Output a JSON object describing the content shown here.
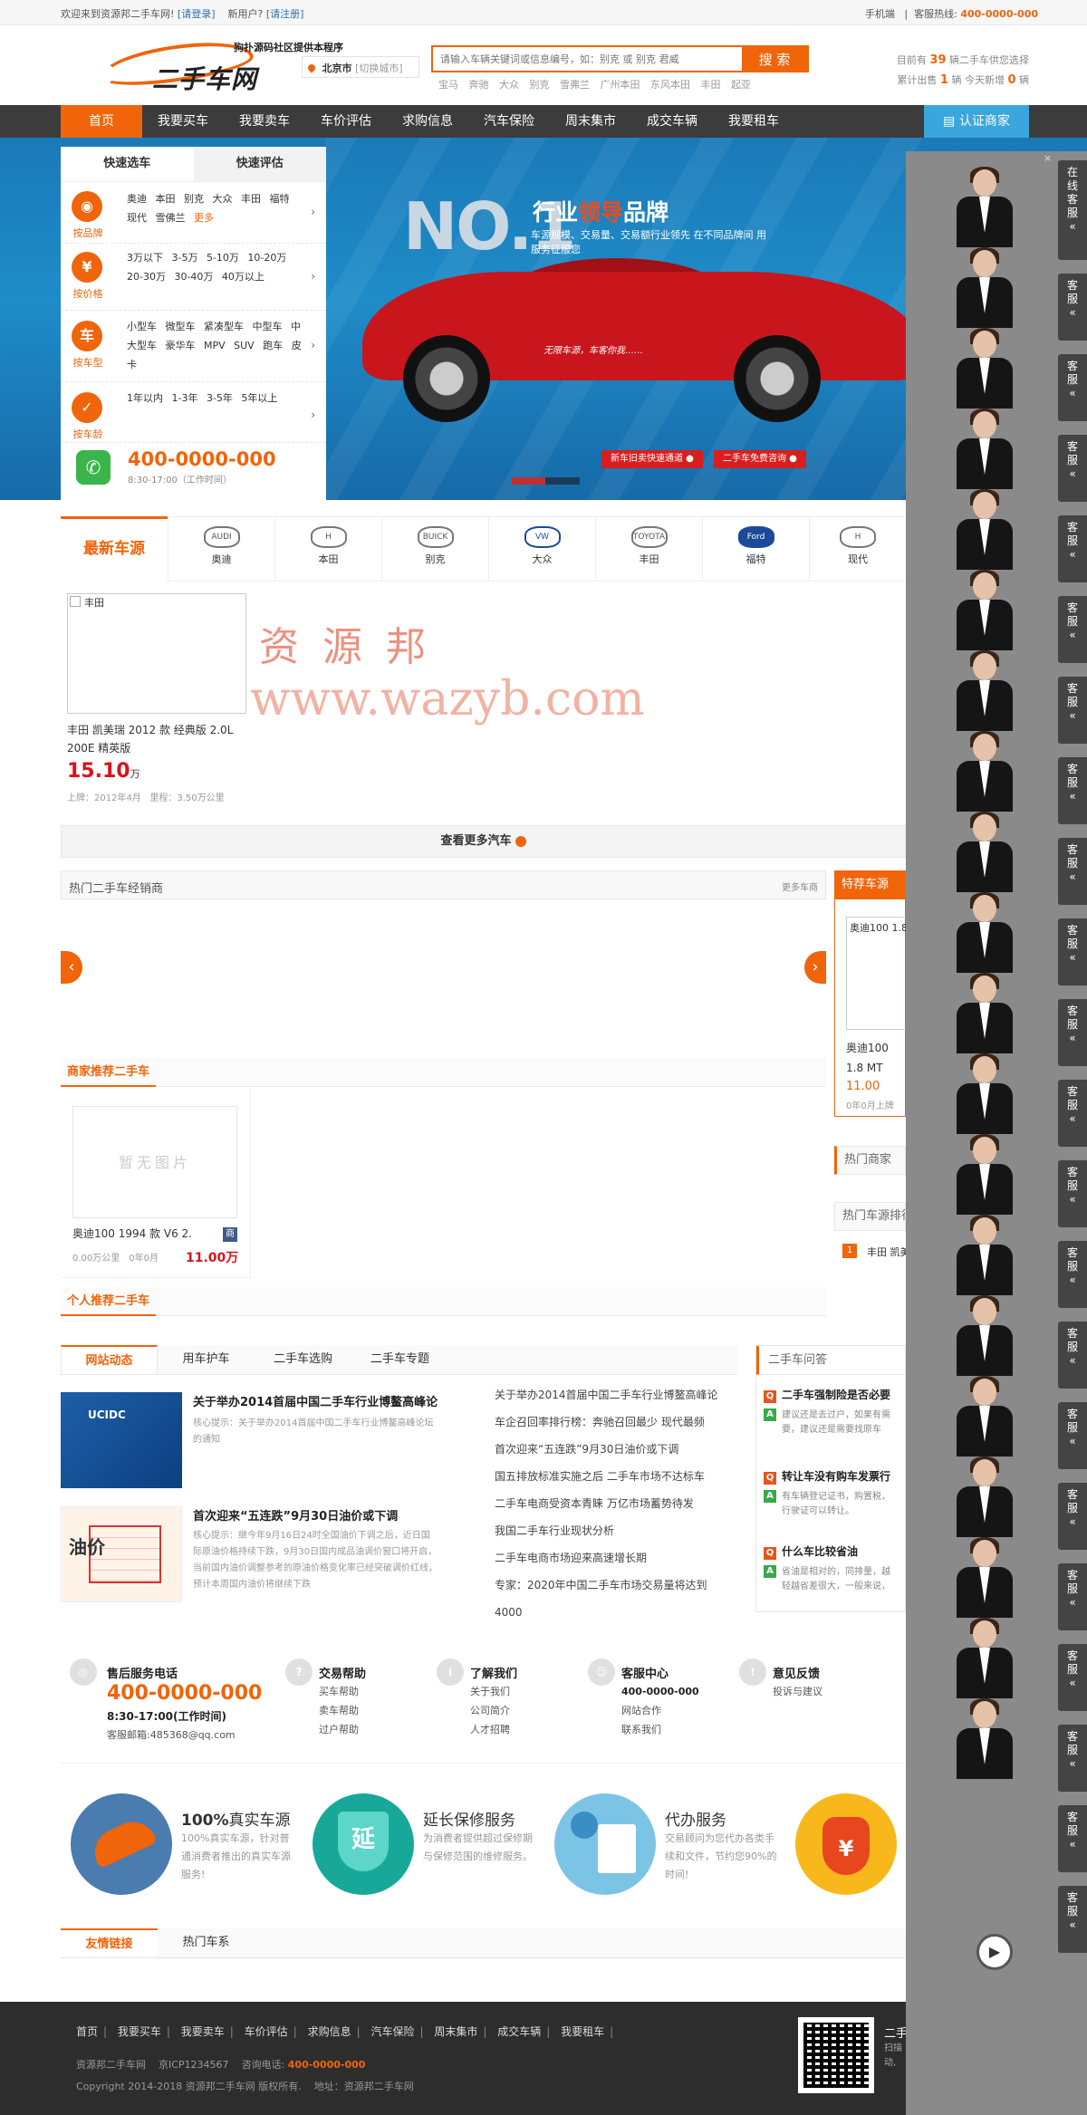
{
  "topbar": {
    "welcome": "欢迎来到资源邦二手车网!",
    "login": "[请登录]",
    "newuser": "新用户?",
    "register": "[请注册]",
    "mobile": "手机端",
    "hotline_label": "客服热线:",
    "hotline": "400-0000-000"
  },
  "header": {
    "logo_text": "二手车网",
    "logo_sub": "狗扑源码社区提供本程序",
    "city": "北京市",
    "city_switch": "[切换城市]",
    "search_placeholder": "请输入车辆关键词或信息编号，如：别克 或 别克 君威",
    "search_btn": "搜 索",
    "hotkeys": "宝马 奔驰 大众 别克 雪弗兰 广州本田 东风本田 丰田 起亚",
    "stat1_pre": "目前有",
    "stat1_num": "39",
    "stat1_post": "辆二手车供您选择",
    "stat2_pre": "累计出售",
    "stat2_num": "1",
    "stat2_mid": "辆 今天新增",
    "stat2_num2": "0",
    "stat2_post": "辆"
  },
  "nav": {
    "items": [
      "首页",
      "我要买车",
      "我要卖车",
      "车价评估",
      "求购信息",
      "汽车保险",
      "周末集市",
      "成交车辆",
      "我要租车"
    ],
    "cert": "认证商家"
  },
  "banner": {
    "no1": "NO.1",
    "slogan_a": "行业",
    "slogan_b": "领导",
    "slogan_c": "品牌",
    "slogan2": "车源规模、交易量、交易额行业领先 在不同品牌间 用服务征服您",
    "btn1": "新车旧卖快速通道",
    "btn2": "二手车免费咨询",
    "car_plate": "无限车源，车客你我……"
  },
  "quick": {
    "tab1": "快速选车",
    "tab2": "快速评估",
    "rows": [
      {
        "icon": "◉",
        "label": "按品牌",
        "text": "奥迪 本田 别克 大众 丰田 福特 现代 雪佛兰",
        "more": "更多"
      },
      {
        "icon": "¥",
        "label": "按价格",
        "text": "3万以下 3-5万 5-10万 10-20万 20-30万 30-40万 40万以上",
        "more": ""
      },
      {
        "icon": "车",
        "label": "按车型",
        "text": "小型车 微型车 紧凑型车 中型车 中大型车 豪华车 MPV SUV 跑车 皮卡",
        "more": ""
      },
      {
        "icon": "✓",
        "label": "按车龄",
        "text": "1年以内 1-3年 3-5年 5年以上",
        "more": ""
      }
    ],
    "phone": "400-0000-000",
    "phone_time": "8:30-17:00（工作时间）"
  },
  "brands": {
    "title": "最新车源",
    "items": [
      {
        "name": "奥迪",
        "logo": "AUDI"
      },
      {
        "name": "本田",
        "logo": "H"
      },
      {
        "name": "别克",
        "logo": "BUICK"
      },
      {
        "name": "大众",
        "logo": "VW"
      },
      {
        "name": "丰田",
        "logo": "TOYOTA"
      },
      {
        "name": "福特",
        "logo": "Ford"
      },
      {
        "name": "现代",
        "logo": "H"
      }
    ]
  },
  "latest": {
    "img_alt": "丰田",
    "name": "丰田 凯美瑞 2012 款 经典版 2.0L 200E 精英版",
    "price": "15.10",
    "unit": "万",
    "reg": "上牌：2012年4月",
    "mileage": "里程：3.50万公里",
    "wm1": "资 源 邦",
    "wm2": "www.wazyb.com",
    "more": "查看更多汽车"
  },
  "dealers": {
    "title": "热门二手车经销商",
    "more": "更多车商",
    "special": "特荐车源",
    "sp_name": "奥迪100 1.8 MT",
    "sp_price": "11.00",
    "sp_meta": "0年0月上牌",
    "side1": "热门商家",
    "side2": "热门车源排行",
    "rank_no": "1",
    "rank_name": "丰田 凯美瑞"
  },
  "merchant": {
    "title": "商家推荐二手车",
    "noimg": "暂无图片",
    "name": "奥迪100 1994 款 V6 2.",
    "tag": "商",
    "meta": "0.00万公里　0年0月",
    "price": "11.00万"
  },
  "personal": {
    "title": "个人推荐二手车"
  },
  "news": {
    "tabs": [
      "网站动态",
      "用车护车",
      "二手车选购",
      "二手车专题"
    ],
    "img1_text": "UCIDC",
    "h1": "关于举办2014首届中国二手车行业博鳌高峰论",
    "d1": "核心提示：关于举办2014首届中国二手车行业博鳌高峰论坛的通知",
    "img2_text": "油价",
    "h2": "首次迎来“五连跌”9月30日油价或下调",
    "d2": "核心提示：继今年9月16日24时全国油价下调之后，近日国际原油价格持续下跌，9月30日国内成品油调价窗口将开启，当前国内油价调整参考的原油价格变化率已经突破调价红线，预计本周国内油价将继续下跌",
    "list": [
      "关于举办2014首届中国二手车行业博鳌高峰论",
      "车企召回率排行榜：奔驰召回最少 现代最频",
      "首次迎来“五连跌”9月30日油价或下调",
      "国五排放标准实施之后 二手车市场不达标车",
      "二手车电商受资本青睐 万亿市场蓄势待发",
      "我国二手车行业现状分析",
      "二手车电商市场迎来高速增长期",
      "专家：2020年中国二手车市场交易量将达到",
      "4000"
    ]
  },
  "qa": {
    "title": "二手车问答",
    "items": [
      {
        "q": "二手车强制险是否必要",
        "a": "建议还是去过户，如果有需要，建议还是需要找原车主，因为"
      },
      {
        "q": "转让车没有购车发票行",
        "a": "有车辆登记证书，购置税，行驶证可以转让。"
      },
      {
        "q": "什么车比较省油",
        "a": "省油是相对的，同排量，越轻越省差很大，一般来说，排量"
      }
    ]
  },
  "service": {
    "c1_h": "售后服务电话",
    "c1_phone": "400-0000-000",
    "c1_time": "8:30-17:00(工作时间)",
    "c1_mail": "客服邮箱:485368@qq.com",
    "c2_h": "交易帮助",
    "c2_l": [
      "买车帮助",
      "卖车帮助",
      "过户帮助"
    ],
    "c3_h": "了解我们",
    "c3_l": [
      "关于我们",
      "公司简介",
      "人才招聘"
    ],
    "c4_h": "客服中心",
    "c4_l": [
      "400-0000-000",
      "网站合作",
      "联系我们"
    ],
    "c5_h": "意见反馈",
    "c5_l": [
      "投诉与建议"
    ]
  },
  "features": [
    {
      "title_a": "100%",
      "title_b": "真实车源",
      "desc": "100%真实车源，针对普通消费者推出的真实车源服务!"
    },
    {
      "title_a": "",
      "title_b": "延长保修服务",
      "desc": "为消费者提供超过保修期与保修范围的维修服务。",
      "icon": "延"
    },
    {
      "title_a": "",
      "title_b": "代办服务",
      "desc": "交易顾问为您代办各类手续和文件，节约您90%的时间!"
    },
    {
      "title_a": "",
      "title_b": "",
      "desc": "",
      "icon": "¥"
    }
  ],
  "friends": {
    "tabs": [
      "友情链接",
      "热门车系"
    ]
  },
  "footer": {
    "nav": [
      "首页",
      "我要买车",
      "我要卖车",
      "车价评估",
      "求购信息",
      "汽车保险",
      "周末集市",
      "成交车辆",
      "我要租车"
    ],
    "site": "资源邦二手车网",
    "icp": "京ICP1234567",
    "consult": "咨询电话:",
    "phone": "400-0000-000",
    "copy": "Copyright 2014-2018 资源邦二手车网 版权所有.",
    "addr": "地址：资源邦二手车网",
    "qr_title": "二手",
    "qr_desc": "扫描动,"
  },
  "chat": {
    "first": "在线客服",
    "label": "客服",
    "close": "×",
    "count": 22,
    "play": "▶"
  },
  "colors": {
    "brand": "#f0640a",
    "nav": "#3c3c3c",
    "banner": "#1e8cc8",
    "price": "#d7141a",
    "footer": "#2d2d2d"
  }
}
